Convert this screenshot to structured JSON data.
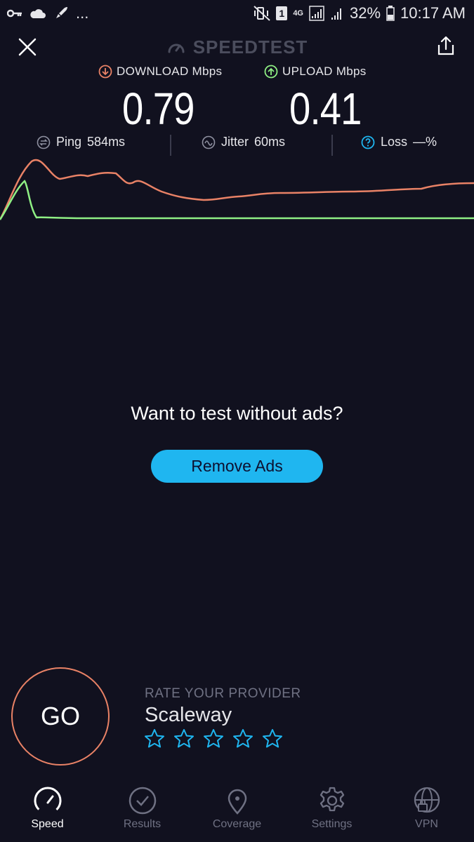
{
  "status_bar": {
    "left_extra": "...",
    "battery": "32%",
    "time": "10:17 AM",
    "network": "4G",
    "sim": "1"
  },
  "header": {
    "title": "SPEEDTEST"
  },
  "metrics": {
    "download": {
      "label": "DOWNLOAD Mbps",
      "value": "0.79",
      "color": "#e98266"
    },
    "upload": {
      "label": "UPLOAD Mbps",
      "value": "0.41",
      "color": "#8ff084"
    }
  },
  "stats": {
    "ping": {
      "label": "Ping",
      "value": "584ms"
    },
    "jitter": {
      "label": "Jitter",
      "value": "60ms"
    },
    "loss": {
      "label": "Loss",
      "value": "—%"
    }
  },
  "promo": {
    "headline": "Want to test without ads?",
    "button": "Remove Ads"
  },
  "go_button": {
    "label": "GO"
  },
  "rating": {
    "label": "RATE YOUR PROVIDER",
    "provider": "Scaleway",
    "stars_total": 5,
    "stars_filled": 0
  },
  "nav": {
    "items": [
      {
        "label": "Speed",
        "icon": "speedometer-icon",
        "active": true
      },
      {
        "label": "Results",
        "icon": "check-circle-icon",
        "active": false
      },
      {
        "label": "Coverage",
        "icon": "map-pin-icon",
        "active": false
      },
      {
        "label": "Settings",
        "icon": "gear-icon",
        "active": false
      },
      {
        "label": "VPN",
        "icon": "globe-lock-icon",
        "active": false
      }
    ]
  },
  "colors": {
    "background": "#11111f",
    "accent": "#1fb6f0",
    "download": "#e98266",
    "upload": "#8ff084"
  }
}
